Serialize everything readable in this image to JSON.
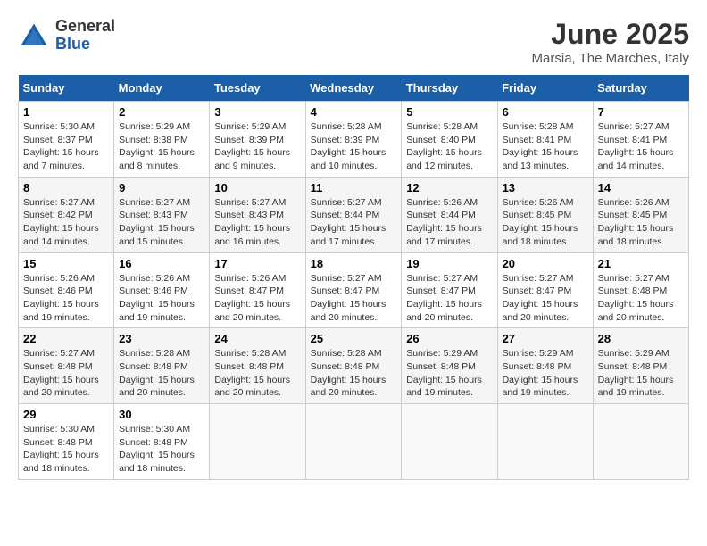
{
  "logo": {
    "general": "General",
    "blue": "Blue"
  },
  "header": {
    "month": "June 2025",
    "location": "Marsia, The Marches, Italy"
  },
  "columns": [
    "Sunday",
    "Monday",
    "Tuesday",
    "Wednesday",
    "Thursday",
    "Friday",
    "Saturday"
  ],
  "weeks": [
    [
      {
        "day": "1",
        "sunrise": "Sunrise: 5:30 AM",
        "sunset": "Sunset: 8:37 PM",
        "daylight": "Daylight: 15 hours and 7 minutes."
      },
      {
        "day": "2",
        "sunrise": "Sunrise: 5:29 AM",
        "sunset": "Sunset: 8:38 PM",
        "daylight": "Daylight: 15 hours and 8 minutes."
      },
      {
        "day": "3",
        "sunrise": "Sunrise: 5:29 AM",
        "sunset": "Sunset: 8:39 PM",
        "daylight": "Daylight: 15 hours and 9 minutes."
      },
      {
        "day": "4",
        "sunrise": "Sunrise: 5:28 AM",
        "sunset": "Sunset: 8:39 PM",
        "daylight": "Daylight: 15 hours and 10 minutes."
      },
      {
        "day": "5",
        "sunrise": "Sunrise: 5:28 AM",
        "sunset": "Sunset: 8:40 PM",
        "daylight": "Daylight: 15 hours and 12 minutes."
      },
      {
        "day": "6",
        "sunrise": "Sunrise: 5:28 AM",
        "sunset": "Sunset: 8:41 PM",
        "daylight": "Daylight: 15 hours and 13 minutes."
      },
      {
        "day": "7",
        "sunrise": "Sunrise: 5:27 AM",
        "sunset": "Sunset: 8:41 PM",
        "daylight": "Daylight: 15 hours and 14 minutes."
      }
    ],
    [
      {
        "day": "8",
        "sunrise": "Sunrise: 5:27 AM",
        "sunset": "Sunset: 8:42 PM",
        "daylight": "Daylight: 15 hours and 14 minutes."
      },
      {
        "day": "9",
        "sunrise": "Sunrise: 5:27 AM",
        "sunset": "Sunset: 8:43 PM",
        "daylight": "Daylight: 15 hours and 15 minutes."
      },
      {
        "day": "10",
        "sunrise": "Sunrise: 5:27 AM",
        "sunset": "Sunset: 8:43 PM",
        "daylight": "Daylight: 15 hours and 16 minutes."
      },
      {
        "day": "11",
        "sunrise": "Sunrise: 5:27 AM",
        "sunset": "Sunset: 8:44 PM",
        "daylight": "Daylight: 15 hours and 17 minutes."
      },
      {
        "day": "12",
        "sunrise": "Sunrise: 5:26 AM",
        "sunset": "Sunset: 8:44 PM",
        "daylight": "Daylight: 15 hours and 17 minutes."
      },
      {
        "day": "13",
        "sunrise": "Sunrise: 5:26 AM",
        "sunset": "Sunset: 8:45 PM",
        "daylight": "Daylight: 15 hours and 18 minutes."
      },
      {
        "day": "14",
        "sunrise": "Sunrise: 5:26 AM",
        "sunset": "Sunset: 8:45 PM",
        "daylight": "Daylight: 15 hours and 18 minutes."
      }
    ],
    [
      {
        "day": "15",
        "sunrise": "Sunrise: 5:26 AM",
        "sunset": "Sunset: 8:46 PM",
        "daylight": "Daylight: 15 hours and 19 minutes."
      },
      {
        "day": "16",
        "sunrise": "Sunrise: 5:26 AM",
        "sunset": "Sunset: 8:46 PM",
        "daylight": "Daylight: 15 hours and 19 minutes."
      },
      {
        "day": "17",
        "sunrise": "Sunrise: 5:26 AM",
        "sunset": "Sunset: 8:47 PM",
        "daylight": "Daylight: 15 hours and 20 minutes."
      },
      {
        "day": "18",
        "sunrise": "Sunrise: 5:27 AM",
        "sunset": "Sunset: 8:47 PM",
        "daylight": "Daylight: 15 hours and 20 minutes."
      },
      {
        "day": "19",
        "sunrise": "Sunrise: 5:27 AM",
        "sunset": "Sunset: 8:47 PM",
        "daylight": "Daylight: 15 hours and 20 minutes."
      },
      {
        "day": "20",
        "sunrise": "Sunrise: 5:27 AM",
        "sunset": "Sunset: 8:47 PM",
        "daylight": "Daylight: 15 hours and 20 minutes."
      },
      {
        "day": "21",
        "sunrise": "Sunrise: 5:27 AM",
        "sunset": "Sunset: 8:48 PM",
        "daylight": "Daylight: 15 hours and 20 minutes."
      }
    ],
    [
      {
        "day": "22",
        "sunrise": "Sunrise: 5:27 AM",
        "sunset": "Sunset: 8:48 PM",
        "daylight": "Daylight: 15 hours and 20 minutes."
      },
      {
        "day": "23",
        "sunrise": "Sunrise: 5:28 AM",
        "sunset": "Sunset: 8:48 PM",
        "daylight": "Daylight: 15 hours and 20 minutes."
      },
      {
        "day": "24",
        "sunrise": "Sunrise: 5:28 AM",
        "sunset": "Sunset: 8:48 PM",
        "daylight": "Daylight: 15 hours and 20 minutes."
      },
      {
        "day": "25",
        "sunrise": "Sunrise: 5:28 AM",
        "sunset": "Sunset: 8:48 PM",
        "daylight": "Daylight: 15 hours and 20 minutes."
      },
      {
        "day": "26",
        "sunrise": "Sunrise: 5:29 AM",
        "sunset": "Sunset: 8:48 PM",
        "daylight": "Daylight: 15 hours and 19 minutes."
      },
      {
        "day": "27",
        "sunrise": "Sunrise: 5:29 AM",
        "sunset": "Sunset: 8:48 PM",
        "daylight": "Daylight: 15 hours and 19 minutes."
      },
      {
        "day": "28",
        "sunrise": "Sunrise: 5:29 AM",
        "sunset": "Sunset: 8:48 PM",
        "daylight": "Daylight: 15 hours and 19 minutes."
      }
    ],
    [
      {
        "day": "29",
        "sunrise": "Sunrise: 5:30 AM",
        "sunset": "Sunset: 8:48 PM",
        "daylight": "Daylight: 15 hours and 18 minutes."
      },
      {
        "day": "30",
        "sunrise": "Sunrise: 5:30 AM",
        "sunset": "Sunset: 8:48 PM",
        "daylight": "Daylight: 15 hours and 18 minutes."
      },
      null,
      null,
      null,
      null,
      null
    ]
  ]
}
